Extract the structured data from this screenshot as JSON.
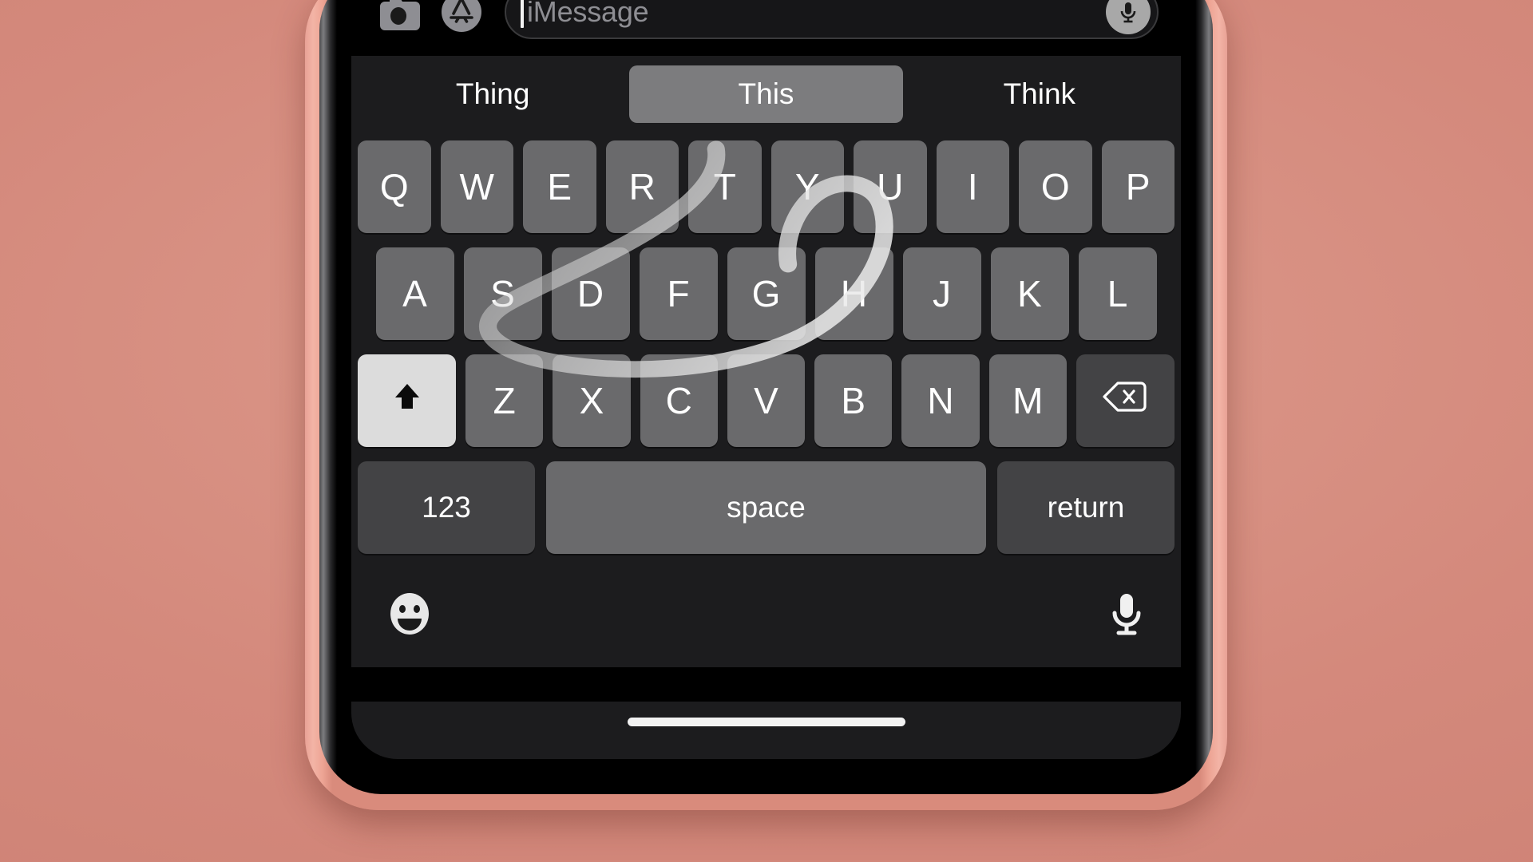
{
  "background": {
    "color": "#d4897c"
  },
  "device": {
    "frame_color": "#eda494",
    "screen_color": "#000000"
  },
  "message_bar": {
    "camera_icon": "camera-icon",
    "appstore_icon": "app-store-icon",
    "input_placeholder": "iMessage",
    "input_value": "",
    "mic_icon": "microphone-icon"
  },
  "keyboard": {
    "background_color": "#1c1c1e",
    "key_color": "#6a6a6c",
    "suggestions": [
      {
        "label": "Thing",
        "selected": false
      },
      {
        "label": "This",
        "selected": true
      },
      {
        "label": "Think",
        "selected": false
      }
    ],
    "rows": [
      {
        "name": "row-1",
        "keys": [
          "Q",
          "W",
          "E",
          "R",
          "T",
          "Y",
          "U",
          "I",
          "O",
          "P"
        ]
      },
      {
        "name": "row-2",
        "keys": [
          "A",
          "S",
          "D",
          "F",
          "G",
          "H",
          "J",
          "K",
          "L"
        ]
      },
      {
        "name": "row-3",
        "keys": [
          "Z",
          "X",
          "C",
          "V",
          "B",
          "N",
          "M"
        ]
      }
    ],
    "shift_key": {
      "name": "shift-key",
      "icon": "shift-arrow-icon",
      "active": true
    },
    "delete_key": {
      "name": "delete-key",
      "icon": "backspace-icon"
    },
    "numbers_key": {
      "label": "123"
    },
    "space_key": {
      "label": "space"
    },
    "return_key": {
      "label": "return"
    },
    "emoji_key": {
      "icon": "smiley-face-icon"
    },
    "dictation_key": {
      "icon": "microphone-icon"
    },
    "swipe_trail": {
      "visible": true,
      "color": "#c8c8c8",
      "description": "QuickPath swipe gesture from T through S curving to H and up to I"
    }
  },
  "home_indicator": {
    "visible": true,
    "color": "#f2f2f2"
  }
}
